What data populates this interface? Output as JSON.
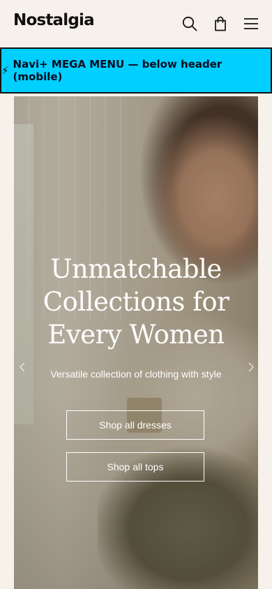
{
  "header": {
    "logo": "Nostalgia",
    "icons": [
      "search-icon",
      "shopping-bag-icon",
      "menu-icon"
    ]
  },
  "mega_menu": {
    "bolt": "⚡",
    "label": "Navi+ MEGA MENU — below header (mobile)",
    "background": "#00cfff"
  },
  "hero": {
    "title_line1": "Unmatchable",
    "title_line2": "Collections for",
    "title_line3": "Every Women",
    "subtitle": "Versatile collection of clothing with style",
    "button_dresses": "Shop all dresses",
    "button_tops": "Shop all tops",
    "arrows": [
      "chevron-left-icon",
      "chevron-right-icon"
    ]
  },
  "colors": {
    "page_background": "#f6f1ea",
    "text_dark": "#111111",
    "banner": "#00cfff"
  }
}
